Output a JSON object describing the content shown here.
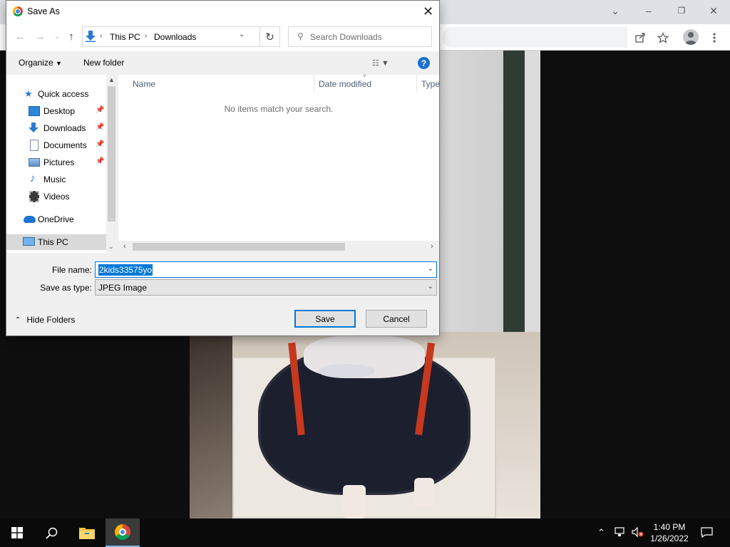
{
  "browser": {
    "window_controls": {
      "minimize": "–",
      "restore": "❐",
      "close": "✕",
      "tab_list": "⌄"
    },
    "toolbar_icons": [
      "share-icon",
      "star-icon",
      "profile-icon",
      "menu-icon"
    ]
  },
  "dialog": {
    "title": "Save As",
    "address": {
      "crumbs": [
        "This PC",
        "Downloads"
      ]
    },
    "search_placeholder": "Search Downloads",
    "commands": {
      "organize": "Organize",
      "new_folder": "New folder"
    },
    "nav_items": [
      {
        "label": "Quick access",
        "icon": "star-icon",
        "pinned": false
      },
      {
        "label": "Desktop",
        "icon": "desktop-icon",
        "pinned": true
      },
      {
        "label": "Downloads",
        "icon": "download-icon",
        "pinned": true
      },
      {
        "label": "Documents",
        "icon": "documents-icon",
        "pinned": true
      },
      {
        "label": "Pictures",
        "icon": "pictures-icon",
        "pinned": true
      },
      {
        "label": "Music",
        "icon": "music-icon",
        "pinned": false
      },
      {
        "label": "Videos",
        "icon": "videos-icon",
        "pinned": false
      },
      {
        "label": "OneDrive",
        "icon": "cloud-icon",
        "pinned": false
      },
      {
        "label": "This PC",
        "icon": "computer-icon",
        "pinned": false
      }
    ],
    "columns": [
      "Name",
      "Date modified",
      "Type"
    ],
    "empty_message": "No items match your search.",
    "file_name_label": "File name:",
    "file_name_value": "2kids33575yo",
    "save_type_label": "Save as type:",
    "save_type_value": "JPEG Image",
    "hide_folders": "Hide Folders",
    "save_button": "Save",
    "cancel_button": "Cancel"
  },
  "taskbar": {
    "time": "1:40 PM",
    "date": "1/26/2022"
  }
}
